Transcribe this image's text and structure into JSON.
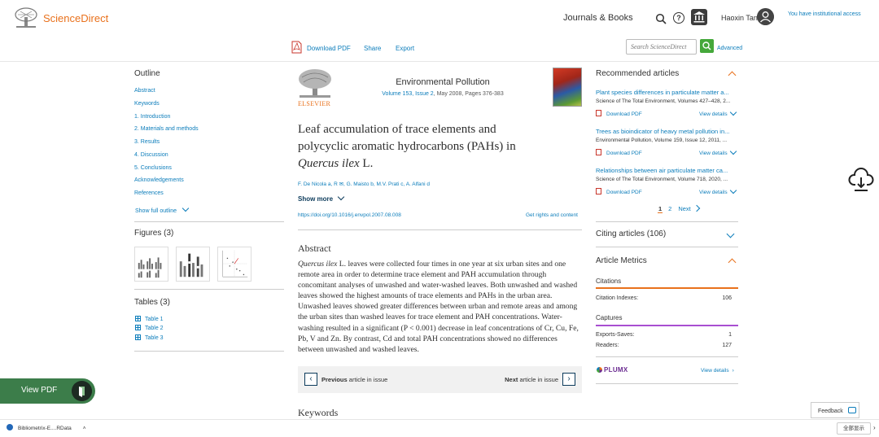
{
  "header": {
    "brand": "ScienceDirect",
    "journals_books": "Journals & Books",
    "help_icon": "?",
    "user_name": "Haoxin Tan",
    "institution_access": "You have institutional access"
  },
  "toolbar": {
    "download_pdf": "Download PDF",
    "share": "Share",
    "export": "Export",
    "search_placeholder": "Search ScienceDirect",
    "advanced": "Advanced"
  },
  "outline": {
    "title": "Outline",
    "items": [
      "Abstract",
      "Keywords",
      "1. Introduction",
      "2. Materials and methods",
      "3. Results",
      "4. Discussion",
      "5. Conclusions",
      "Acknowledgements",
      "References"
    ],
    "show_full": "Show full outline",
    "figures_title": "Figures (3)",
    "tables_title": "Tables (3)",
    "tables": [
      "Table 1",
      "Table 2",
      "Table 3"
    ]
  },
  "article": {
    "publisher": "ELSEVIER",
    "journal_name": "Environmental Pollution",
    "volume_link": "Volume 153, Issue 2",
    "volume_rest": ", May 2008, Pages 376-383",
    "title_line1": "Leaf accumulation of trace elements and",
    "title_line2": "polycyclic aromatic hydrocarbons (PAHs) in",
    "title_italic": "Quercus ilex",
    "title_end": " L.",
    "authors": "F. De Nicola a, R ✉, G. Maisto b, M.V. Prati c, A. Alfani d",
    "show_more": "Show more",
    "doi": "https://doi.org/10.1016/j.envpol.2007.08.008",
    "get_rights": "Get rights and content",
    "abstract_heading": "Abstract",
    "abstract_italic": "Quercus ilex",
    "abstract_text": " L. leaves were collected four times in one year at six urban sites and one remote area in order to determine trace element and PAH accumulation through concomitant analyses of unwashed and water-washed leaves. Both unwashed and washed leaves showed the highest amounts of trace elements and PAHs in the urban area. Unwashed leaves showed greater differences between urban and remote areas and among the urban sites than washed leaves for trace element and PAH concentrations. Water-washing resulted in a significant (P < 0.001) decrease in leaf concentrations of Cr, Cu, Fe, Pb, V and Zn. By contrast, Cd and total PAH concentrations showed no differences between unwashed and washed leaves.",
    "prev_bold": "Previous",
    "prev_rest": " article in issue",
    "next_bold": "Next",
    "next_rest": " article in issue",
    "keywords_heading": "Keywords"
  },
  "recommended": {
    "title": "Recommended articles",
    "items": [
      {
        "title": "Plant species differences in particulate matter a...",
        "source": "Science of The Total Environment, Volumes 427–428, 2...",
        "pdf": "Download PDF",
        "view": "View details"
      },
      {
        "title": "Trees as bioindicator of heavy metal pollution in...",
        "source": "Environmental Pollution, Volume 159, Issue 12, 2011, ...",
        "pdf": "Download PDF",
        "view": "View details"
      },
      {
        "title": "Relationships between air particulate matter ca...",
        "source": "Science of The Total Environment, Volume 718, 2020, ...",
        "pdf": "Download PDF",
        "view": "View details"
      }
    ],
    "page1": "1",
    "page2": "2",
    "next": "Next"
  },
  "metrics": {
    "citing": "Citing articles (106)",
    "title": "Article Metrics",
    "citations_label": "Citations",
    "citation_indexes_label": "Citation Indexes:",
    "citation_indexes_value": "106",
    "captures_label": "Captures",
    "exports_saves_label": "Exports-Saves:",
    "exports_saves_value": "1",
    "readers_label": "Readers:",
    "readers_value": "127",
    "plumx": "PLUMX",
    "view_details": "View details"
  },
  "floating": {
    "view_pdf": "View PDF",
    "feedback": "Feedback",
    "download_item": "Bibliometrix-E....RData",
    "show_all": "全部显示"
  },
  "colors": {
    "brand_orange": "#e9711c",
    "link_blue": "#0c7dbb",
    "view_pdf_green": "#3c7d4a",
    "search_green": "#45a83b",
    "captures_purple": "#a84fd1"
  }
}
